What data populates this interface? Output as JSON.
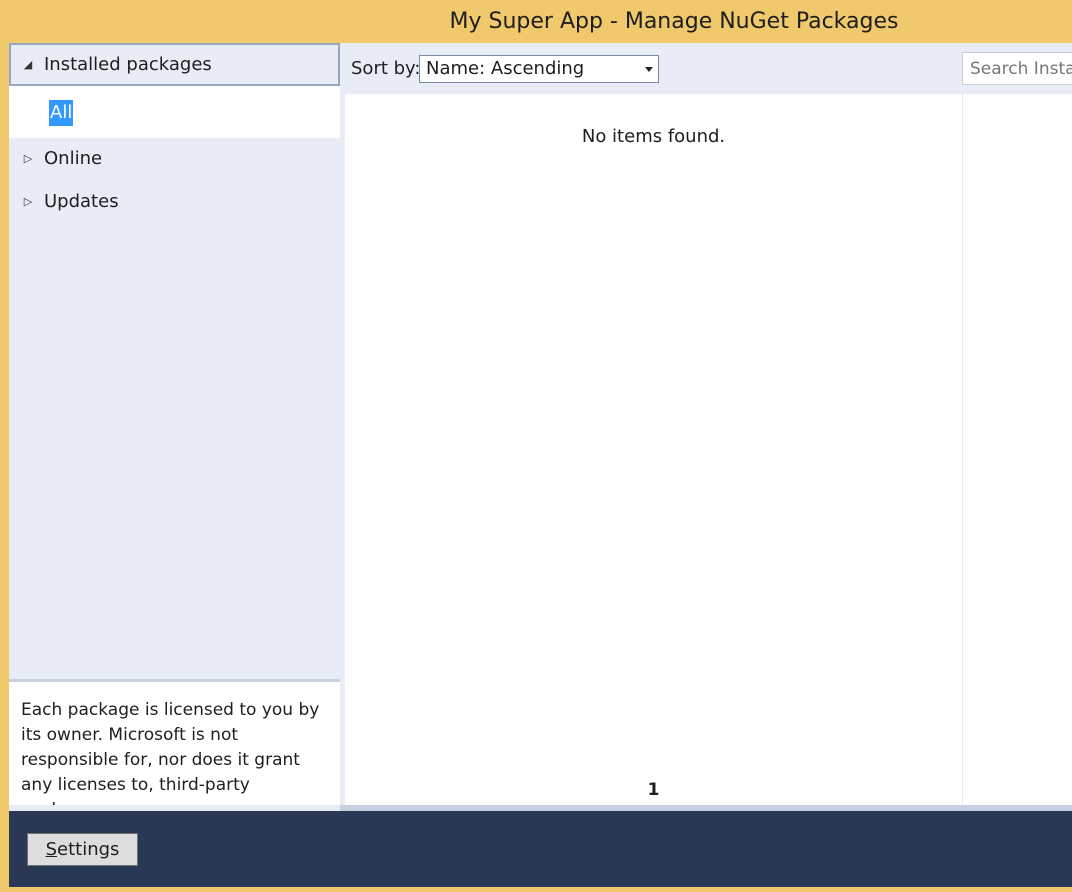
{
  "window": {
    "title": "My Super App - Manage NuGet Packages"
  },
  "nav": {
    "installed": {
      "label": "Installed packages",
      "expanded": true,
      "children": [
        {
          "label": "All",
          "selected": true
        }
      ]
    },
    "online": {
      "label": "Online",
      "expanded": false
    },
    "updates": {
      "label": "Updates",
      "expanded": false
    }
  },
  "license_text": "Each package is licensed to you by its owner. Microsoft is not responsible for, nor does it grant any licenses to, third-party packages.",
  "toolbar": {
    "sort_label": "Sort by:",
    "sort_value": "Name: Ascending",
    "search_placeholder": "Search Installed Packages"
  },
  "results": {
    "empty_message": "No items found.",
    "current_page": "1"
  },
  "footer": {
    "settings_mnemonic": "S",
    "settings_rest": "ettings"
  },
  "colors": {
    "title_bar": "#f0c96c",
    "nav_background": "#e8ecf6",
    "selection": "#3399ff",
    "footer": "#293955"
  },
  "icons": {
    "expanded": "triangle-down-right-icon",
    "collapsed": "triangle-right-outline-icon",
    "dropdown": "caret-down-icon"
  }
}
